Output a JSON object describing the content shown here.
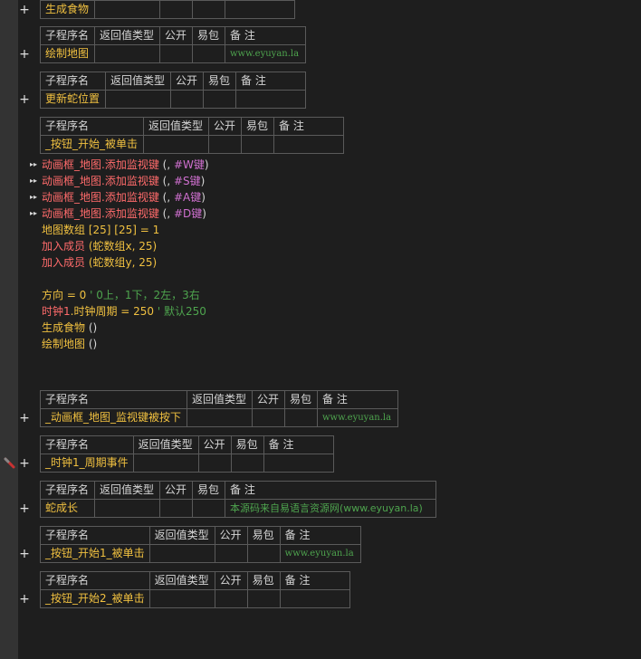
{
  "header_cols": {
    "name": "子程序名",
    "ret": "返回值类型",
    "pub": "公开",
    "easy": "易包",
    "note": "备 注"
  },
  "subs": [
    {
      "name": "生成食物",
      "note": ""
    },
    {
      "name": "绘制地图",
      "note": "www.eyuyan.la"
    },
    {
      "name": "更新蛇位置",
      "note": ""
    },
    {
      "name": "_按钮_开始_被单击",
      "note": ""
    },
    {
      "name": "_动画框_地图_监视键被按下",
      "note": "www.eyuyan.la"
    },
    {
      "name": "_时钟1_周期事件",
      "note": ""
    },
    {
      "name": "蛇成长",
      "note": "本源码来自易语言资源网(www.eyuyan.la)"
    },
    {
      "name": "_按钮_开始1_被单击",
      "note": "www.eyuyan.la"
    },
    {
      "name": "_按钮_开始2_被单击",
      "note": ""
    }
  ],
  "code": {
    "watch_obj": "动画框_地图",
    "watch_method": "添加监视键",
    "watch_open": " (, ",
    "watch_close": ")",
    "keys": [
      "#W键",
      "#S键",
      "#A键",
      "#D键"
    ],
    "line_map": "地图数组 [25] [25] = 1",
    "line_add1_fn": "加入成员",
    "line_add1_args": " (蛇数组x, 25)",
    "line_add2_fn": "加入成员",
    "line_add2_args": " (蛇数组y, 25)",
    "line_dir": "方向 = 0",
    "line_dir_cmt": "' 0上，1下，2左，3右",
    "line_clock_obj": "时钟1",
    "line_clock_rest": ".时钟周期 = 250",
    "line_clock_cmt": "' 默认250",
    "line_gen_fn": "生成食物",
    "line_draw_fn": "绘制地图",
    "call_parens": " ()"
  },
  "plus_glyph": "+",
  "arrow_glyph": "▸▸"
}
